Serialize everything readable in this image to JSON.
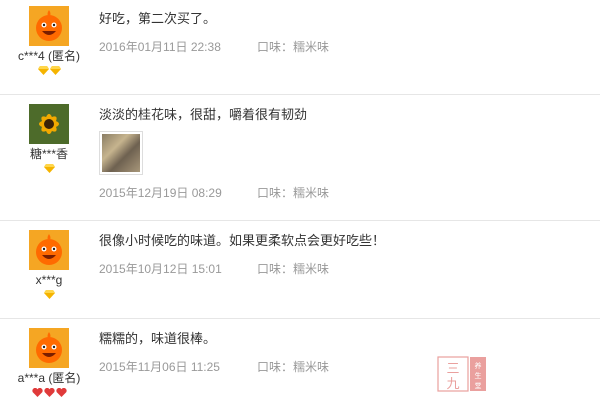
{
  "reviews": [
    {
      "username": "c***4 (匿名)",
      "text": "好吃，第二次买了。",
      "date": "2016年01月11日 22:38",
      "flavor_label": "口味：",
      "flavor_value": "糯米味",
      "badge_color": "#f5b400"
    },
    {
      "username": "糖***香",
      "text": "淡淡的桂花味，很甜，嚼着很有韧劲",
      "date": "2015年12月19日 08:29",
      "flavor_label": "口味：",
      "flavor_value": "糯米味",
      "badge_color": "#f5b400"
    },
    {
      "username": "x***g",
      "text": "很像小时候吃的味道。如果更柔软点会更好吃些！",
      "date": "2015年10月12日 15:01",
      "flavor_label": "口味：",
      "flavor_value": "糯米味",
      "badge_color": "#f5b400"
    },
    {
      "username": "a***a (匿名)",
      "text": "糯糯的，味道很棒。",
      "date": "2015年11月06日 11:25",
      "flavor_label": "口味：",
      "flavor_value": "糯米味",
      "badge_color": "#e03a3a"
    }
  ],
  "watermark": {
    "text": "三九",
    "small_text": "养生堂"
  },
  "colors": {
    "divider": "#e6e6e6",
    "meta_text": "#999999",
    "body_text": "#333333",
    "avatar_bg": "#f5a623",
    "avatar_face": "#ff6a00"
  }
}
